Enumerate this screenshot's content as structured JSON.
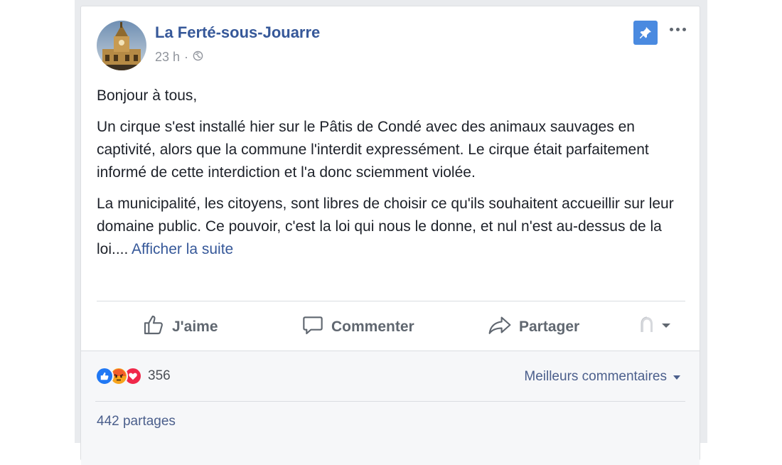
{
  "post": {
    "page_name": "La Ferté-sous-Jouarre",
    "time": "23 h",
    "separator": "·",
    "audience_icon": "globe-icon",
    "paragraphs": [
      "Bonjour à tous,",
      "Un cirque s'est installé hier sur le Pâtis de Condé avec des animaux sauvages en captivité, alors que la commune l'interdit expressément. Le cirque était parfaitement informé de cette interdiction et l'a donc sciemment violée.",
      "La municipalité, les citoyens, sont libres de choisir ce qu'ils souhaitent accueillir sur leur domaine public. Ce pouvoir, c'est la loi qui nous le donne, et nul n'est au-dessus de la loi...."
    ],
    "see_more": "Afficher la suite"
  },
  "actions": {
    "like": "J'aime",
    "comment": "Commenter",
    "share": "Partager"
  },
  "footer": {
    "reaction_count": "356",
    "reactions": [
      "like",
      "angry",
      "love"
    ],
    "sort_label": "Meilleurs commentaires",
    "shares": "442 partages"
  },
  "colors": {
    "link_blue": "#365899",
    "pin_blue": "#4a8ae0",
    "like_blue": "#2078f4",
    "love_red": "#f0284a",
    "angry_orange": "#f7a41d"
  }
}
